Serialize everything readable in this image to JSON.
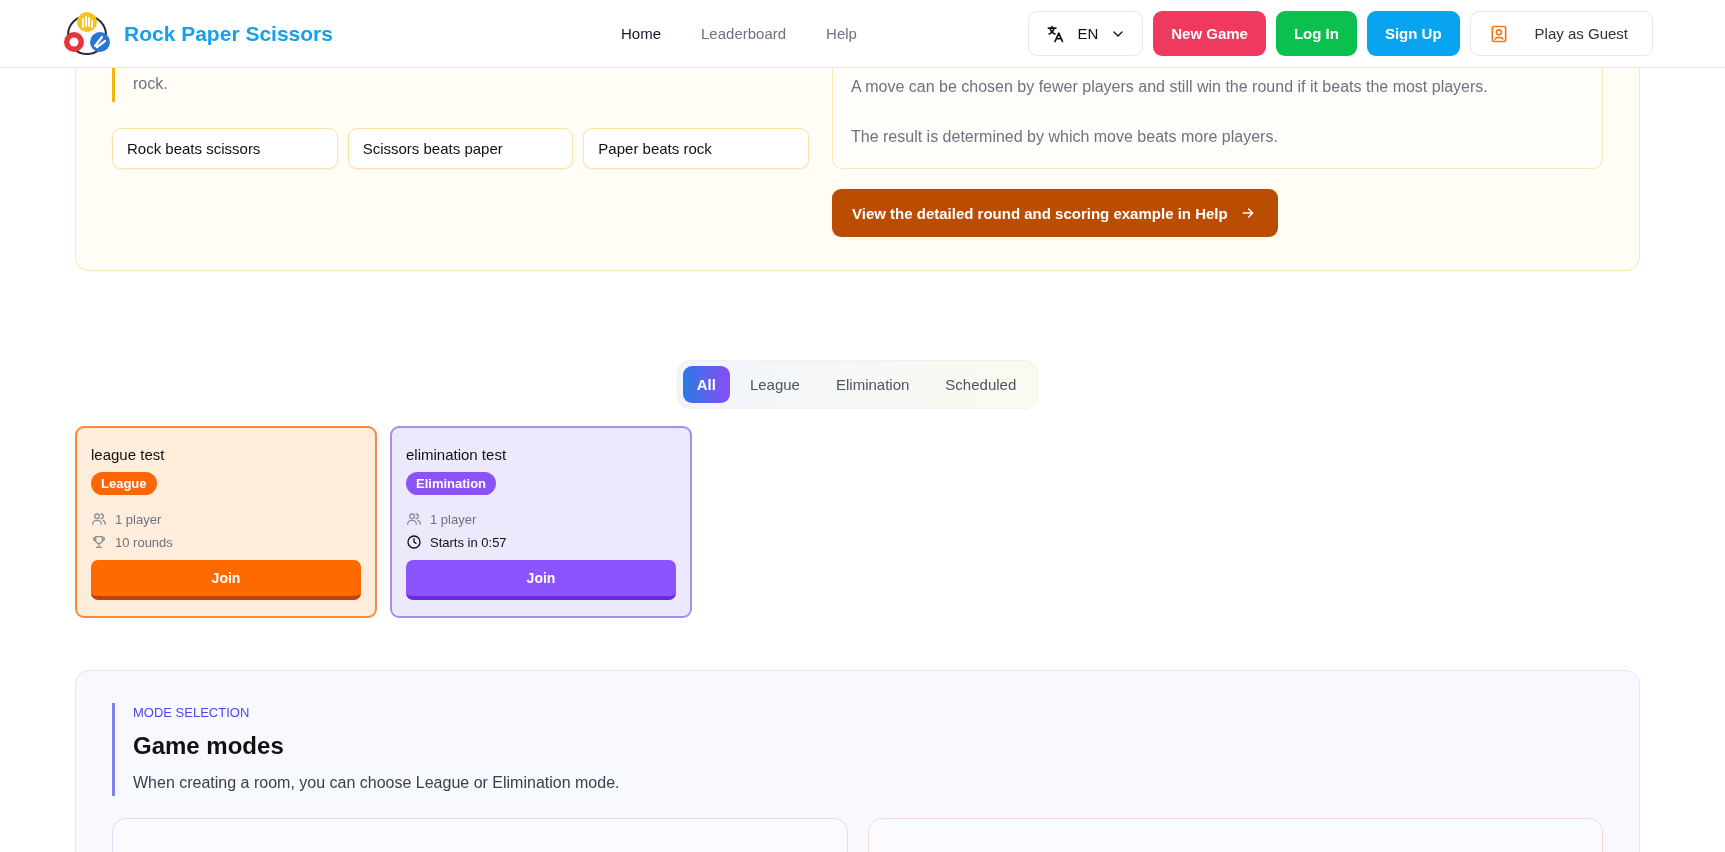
{
  "header": {
    "brand": "Rock Paper Scissors",
    "nav": [
      {
        "label": "Home",
        "selected": true
      },
      {
        "label": "Leaderboard",
        "selected": false
      },
      {
        "label": "Help",
        "selected": false
      }
    ],
    "language": "EN",
    "actions": [
      {
        "label": "New Game",
        "kind": "new"
      },
      {
        "label": "Log In",
        "kind": "login"
      },
      {
        "label": "Sign Up",
        "kind": "signup"
      },
      {
        "label": "Play as Guest",
        "kind": "guest"
      }
    ]
  },
  "rules": {
    "text": "rock.",
    "chips": [
      "Rock beats scissors",
      "Scissors beats paper",
      "Paper beats rock"
    ],
    "notes": [
      "A move can be chosen by fewer players and still win the round if it beats the most players.",
      "The result is determined by which move beats more players."
    ],
    "help_link": "View the detailed round and scoring example in Help"
  },
  "filter_tabs": [
    {
      "label": "All",
      "selected": true
    },
    {
      "label": "League",
      "selected": false
    },
    {
      "label": "Elimination",
      "selected": false
    },
    {
      "label": "Scheduled",
      "selected": false
    }
  ],
  "rooms": [
    {
      "name": "league test",
      "mode": "League",
      "kind": "league",
      "meta": [
        {
          "kind": "players",
          "text": "1 player"
        },
        {
          "kind": "rounds",
          "text": "10 rounds"
        }
      ],
      "join": "Join"
    },
    {
      "name": "elimination test",
      "mode": "Elimination",
      "kind": "elimination",
      "meta": [
        {
          "kind": "players",
          "text": "1 player"
        },
        {
          "kind": "countdown",
          "text": "Starts in 0:57"
        }
      ],
      "join": "Join"
    }
  ],
  "modes": {
    "eyebrow": "MODE SELECTION",
    "title": "Game modes",
    "description": "When creating a room, you can choose League or Elimination mode.",
    "cards": [
      {
        "color": "#dcdcf8"
      },
      {
        "color": "#f8d6d6"
      }
    ]
  }
}
